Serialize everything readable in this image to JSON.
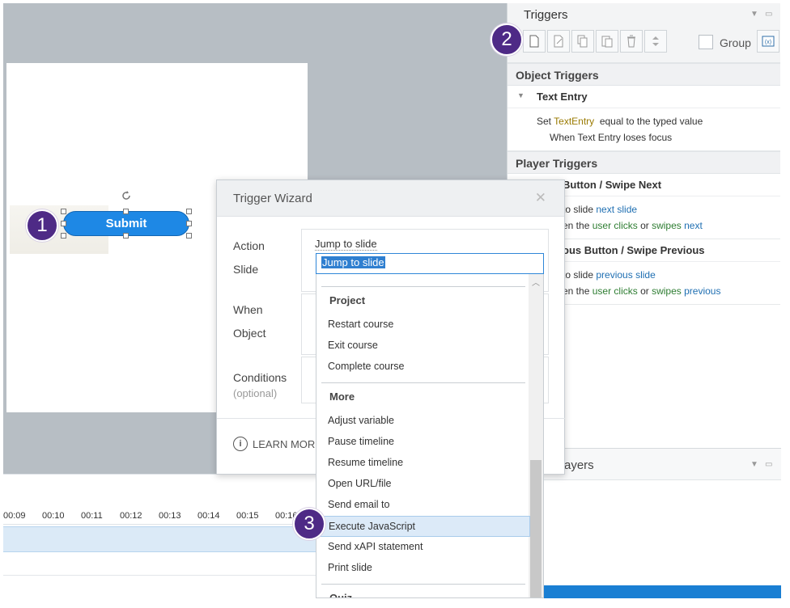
{
  "slide": {
    "submit_label": "Submit"
  },
  "timeline": {
    "ticks": [
      "00:09",
      "00:10",
      "00:11",
      "00:12",
      "00:13",
      "00:14",
      "00:15",
      "00:16"
    ]
  },
  "markers": {
    "m1": "1",
    "m2": "2",
    "m3": "3"
  },
  "triggers_panel": {
    "title": "Triggers",
    "group_label": "Group",
    "object_triggers_title": "Object Triggers",
    "text_entry_group": "Text Entry",
    "text_entry_set": "Set",
    "text_entry_var": "TextEntry",
    "text_entry_equal": "equal to the typed value",
    "text_entry_when": "When Text Entry loses focus",
    "player_triggers_title": "Player Triggers",
    "next_group": "Button / Swipe Next",
    "next_action_prefix": "to slide",
    "next_action_target": "next slide",
    "next_when_prefix": "en the",
    "next_when_user": "user clicks",
    "next_when_or": "or",
    "next_when_swipes": "swipes",
    "next_when_dir": "next",
    "prev_group": "ous Button / Swipe Previous",
    "prev_action_prefix": "to slide",
    "prev_action_target": "previous slide",
    "prev_when_prefix": "en the",
    "prev_when_user": "user clicks",
    "prev_when_or": "or",
    "prev_when_swipes": "swipes",
    "prev_when_dir": "previous",
    "layers_title": "ayers"
  },
  "dialog": {
    "title": "Trigger Wizard",
    "action_label": "Action",
    "slide_label": "Slide",
    "when_label": "When",
    "object_label": "Object",
    "conditions_label": "Conditions",
    "conditions_sub": "(optional)",
    "action_value": "Jump to slide",
    "search_value": "Jump to slide",
    "learn_more": "LEARN MORE"
  },
  "dropdown": {
    "categories": [
      "Project",
      "More",
      "Quiz"
    ],
    "project_items": [
      "Restart course",
      "Exit course",
      "Complete course"
    ],
    "more_items": [
      "Adjust variable",
      "Pause timeline",
      "Resume timeline",
      "Open URL/file",
      "Send email to",
      "Execute JavaScript",
      "Send xAPI statement",
      "Print slide"
    ],
    "highlighted": "Execute JavaScript"
  },
  "colors": {
    "accent": "#1e88e5",
    "marker": "#4e2a86",
    "highlight": "#dceaf8"
  }
}
